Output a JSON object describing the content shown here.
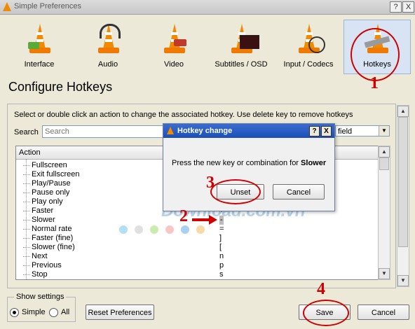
{
  "window": {
    "title": "Simple Preferences",
    "help_btn": "?",
    "close_btn": "X"
  },
  "categories": [
    {
      "label": "Interface"
    },
    {
      "label": "Audio"
    },
    {
      "label": "Video"
    },
    {
      "label": "Subtitles / OSD"
    },
    {
      "label": "Input / Codecs"
    },
    {
      "label": "Hotkeys"
    }
  ],
  "page": {
    "title": "Configure Hotkeys",
    "instructions": "Select or double click an action to change the associated hotkey. Use delete key to remove hotkeys",
    "search_label": "Search",
    "search_placeholder": "Search",
    "field_selected": "field"
  },
  "table": {
    "column_action": "Action",
    "rows": [
      {
        "action": "Fullscreen",
        "key": ""
      },
      {
        "action": "Exit fullscreen",
        "key": ""
      },
      {
        "action": "Play/Pause",
        "key": ""
      },
      {
        "action": "Pause only",
        "key": ""
      },
      {
        "action": "Play only",
        "key": ""
      },
      {
        "action": "Faster",
        "key": "+"
      },
      {
        "action": "Slower",
        "key": "-"
      },
      {
        "action": "Normal rate",
        "key": "="
      },
      {
        "action": "Faster (fine)",
        "key": "]"
      },
      {
        "action": "Slower (fine)",
        "key": "["
      },
      {
        "action": "Next",
        "key": "n"
      },
      {
        "action": "Previous",
        "key": "p"
      },
      {
        "action": "Stop",
        "key": "s"
      }
    ]
  },
  "show_settings": {
    "title": "Show settings",
    "simple": "Simple",
    "all": "All",
    "selected": "Simple"
  },
  "buttons": {
    "reset": "Reset Preferences",
    "save": "Save",
    "cancel": "Cancel"
  },
  "dialog": {
    "title": "Hotkey change",
    "help_btn": "?",
    "close_btn": "X",
    "message": "Press the new key or combination for",
    "action_name": "Slower",
    "unset": "Unset",
    "cancel": "Cancel"
  },
  "annotations": {
    "n1": "1",
    "n2": "2",
    "n3": "3",
    "n4": "4",
    "color": "#d00000"
  },
  "watermark": {
    "text": "Download.com.vn"
  },
  "colors": {
    "window_bg": "#ece9d8",
    "dialog_title": "#1b4fb8",
    "cone": "#f28a00",
    "selected_category": "#d8e4f4"
  }
}
